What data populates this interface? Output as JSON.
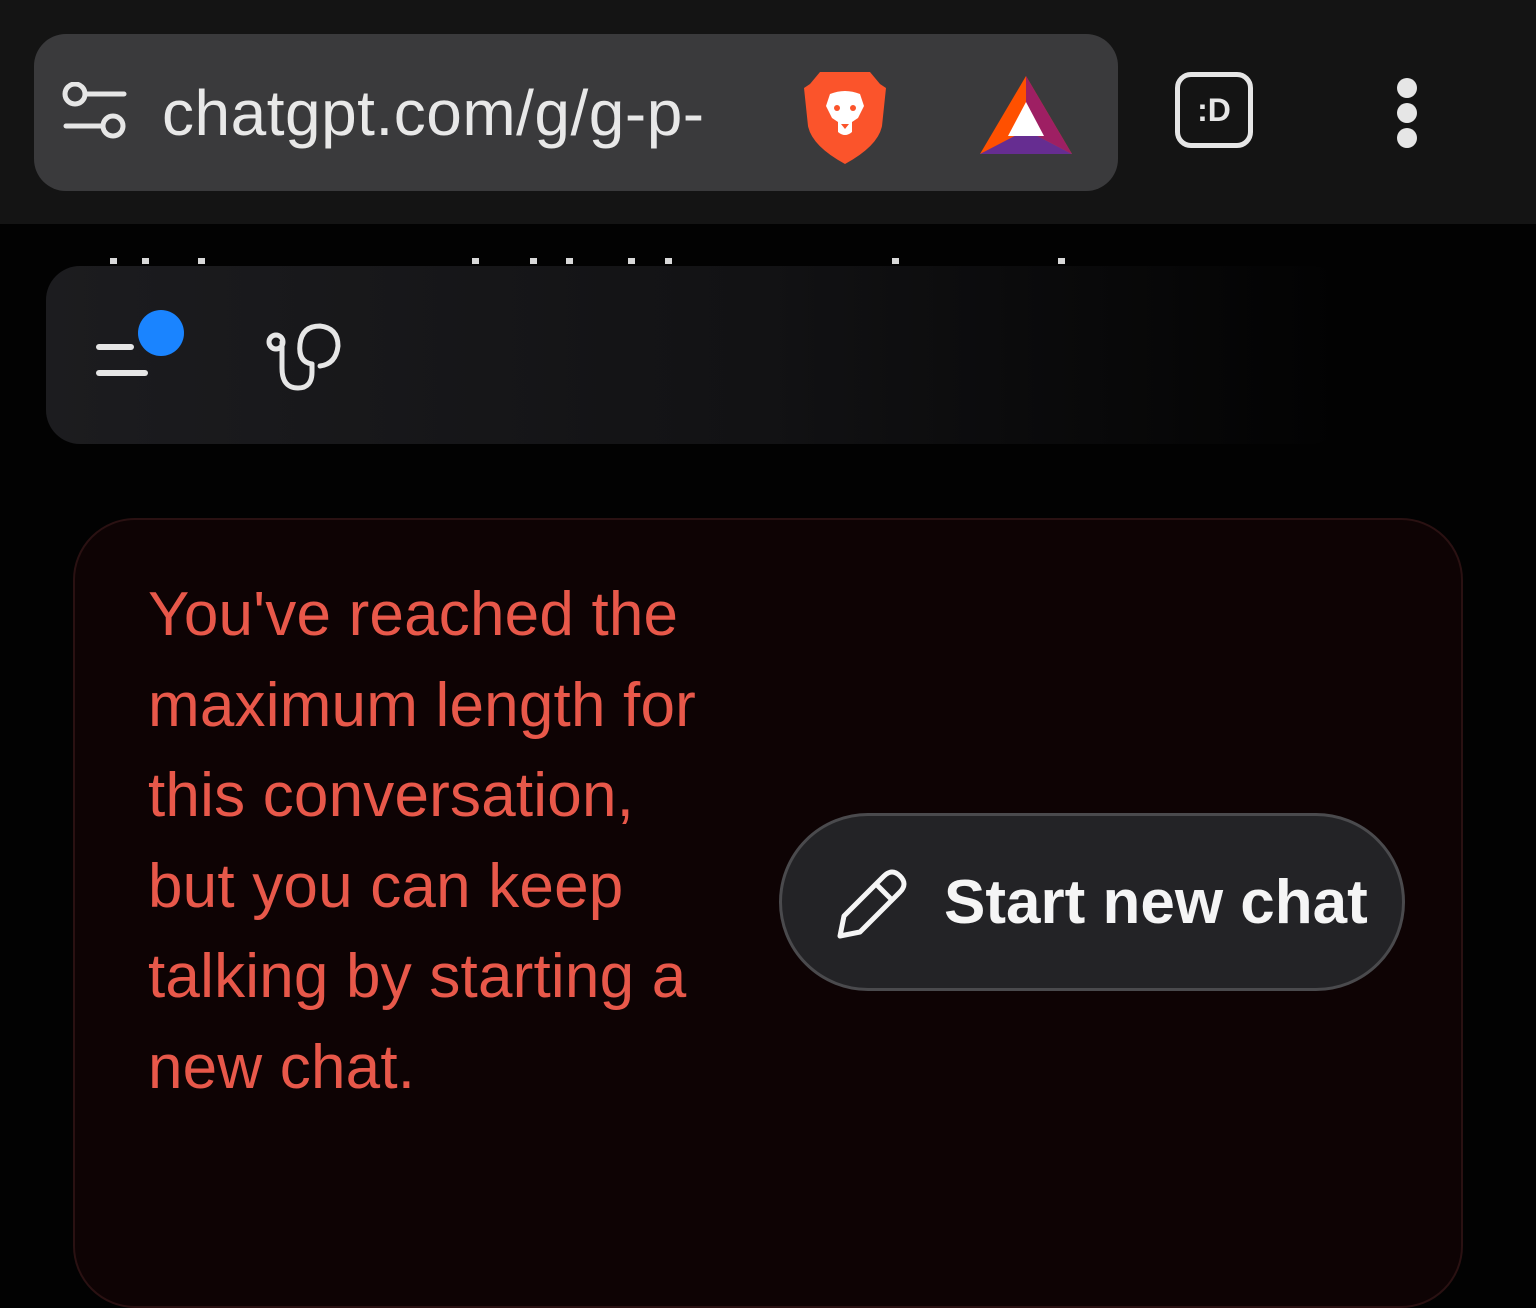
{
  "browser": {
    "url": "chatgpt.com/g/g-p-",
    "tab_switcher_label": ":D",
    "icons": {
      "site_settings": "tune-icon",
      "shields": "brave-lion-icon",
      "rewards": "bat-triangle-icon",
      "menu": "more-vertical-icon"
    }
  },
  "app_header": {
    "icons": [
      "sidebar-toggle-icon",
      "stethoscope-icon"
    ],
    "notification_dot_color": "#1a84ff"
  },
  "notice": {
    "message": "You've reached the maximum length for this conversation, but you can keep talking by starting a new chat.",
    "color": "#e8584a",
    "action": {
      "label": "Start new chat",
      "icon": "pencil-icon"
    }
  }
}
